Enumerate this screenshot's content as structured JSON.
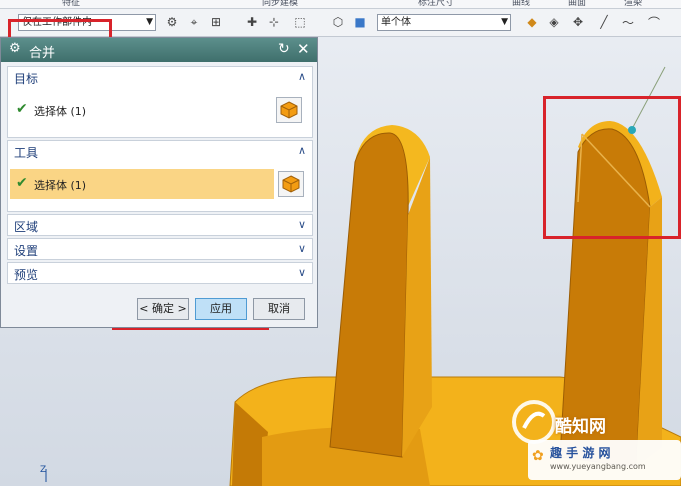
{
  "topstrip": [
    "特征",
    "同步建模",
    "标注尺寸",
    "曲线",
    "曲面",
    "渲染"
  ],
  "toolbar": {
    "filter_combo": "仅在工作部件内",
    "scope_combo": "单个体",
    "icons": [
      "snap-icon",
      "point-icon",
      "box-select-icon",
      "dropdown-icon",
      "wireframe-icon",
      "solid-cube-icon",
      "shade-icon",
      "diamond-icon",
      "view-icon",
      "move-icon",
      "line-icon",
      "curve-icon"
    ]
  },
  "dialog": {
    "title": "合并",
    "target": {
      "label": "目标",
      "row": "选择体 (1)"
    },
    "tool": {
      "label": "工具",
      "row": "选择体 (1)"
    },
    "collapsed": [
      "区域",
      "设置",
      "预览"
    ],
    "buttons": {
      "ok": "< 确定 >",
      "apply": "应用",
      "cancel": "取消"
    }
  },
  "watermark": {
    "site": "酷知网",
    "badge_name": "趣 手 游 网",
    "badge_url": "www.yueyangbang.com"
  },
  "axes_label": "Z"
}
